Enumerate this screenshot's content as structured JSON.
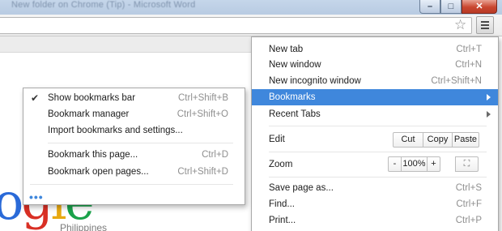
{
  "window": {
    "title": "New folder on Chrome (Tip) - Microsoft Word",
    "buttons": {
      "minimize": "–",
      "maximize": "□",
      "close": "✕"
    }
  },
  "toolbar": {
    "star_icon": "star-icon",
    "menu_icon": "hamburger-icon"
  },
  "logo": {
    "text": "ogle",
    "sub": "Philippines"
  },
  "main_menu": {
    "new_tab": {
      "label": "New tab",
      "shortcut": "Ctrl+T"
    },
    "new_window": {
      "label": "New window",
      "shortcut": "Ctrl+N"
    },
    "new_incognito": {
      "label": "New incognito window",
      "shortcut": "Ctrl+Shift+N"
    },
    "bookmarks": {
      "label": "Bookmarks"
    },
    "recent_tabs": {
      "label": "Recent Tabs"
    },
    "edit": {
      "label": "Edit",
      "cut": "Cut",
      "copy": "Copy",
      "paste": "Paste"
    },
    "zoom": {
      "label": "Zoom",
      "minus": "-",
      "level": "100%",
      "plus": "+",
      "fullscreen": "⛶"
    },
    "save_page": {
      "label": "Save page as...",
      "shortcut": "Ctrl+S"
    },
    "find": {
      "label": "Find...",
      "shortcut": "Ctrl+F"
    },
    "print": {
      "label": "Print...",
      "shortcut": "Ctrl+P"
    }
  },
  "bookmarks_menu": {
    "show_bar": {
      "label": "Show bookmarks bar",
      "shortcut": "Ctrl+Shift+B",
      "checked": true
    },
    "manager": {
      "label": "Bookmark manager",
      "shortcut": "Ctrl+Shift+O"
    },
    "import": {
      "label": "Import bookmarks and settings..."
    },
    "bookmark_page": {
      "label": "Bookmark this page...",
      "shortcut": "Ctrl+D"
    },
    "bookmark_open": {
      "label": "Bookmark open pages...",
      "shortcut": "Ctrl+Shift+D"
    },
    "more": "•••"
  },
  "colors": {
    "highlight": "#3f87dc",
    "titlebar": "#c5d6ea",
    "close_button": "#c9462f"
  }
}
